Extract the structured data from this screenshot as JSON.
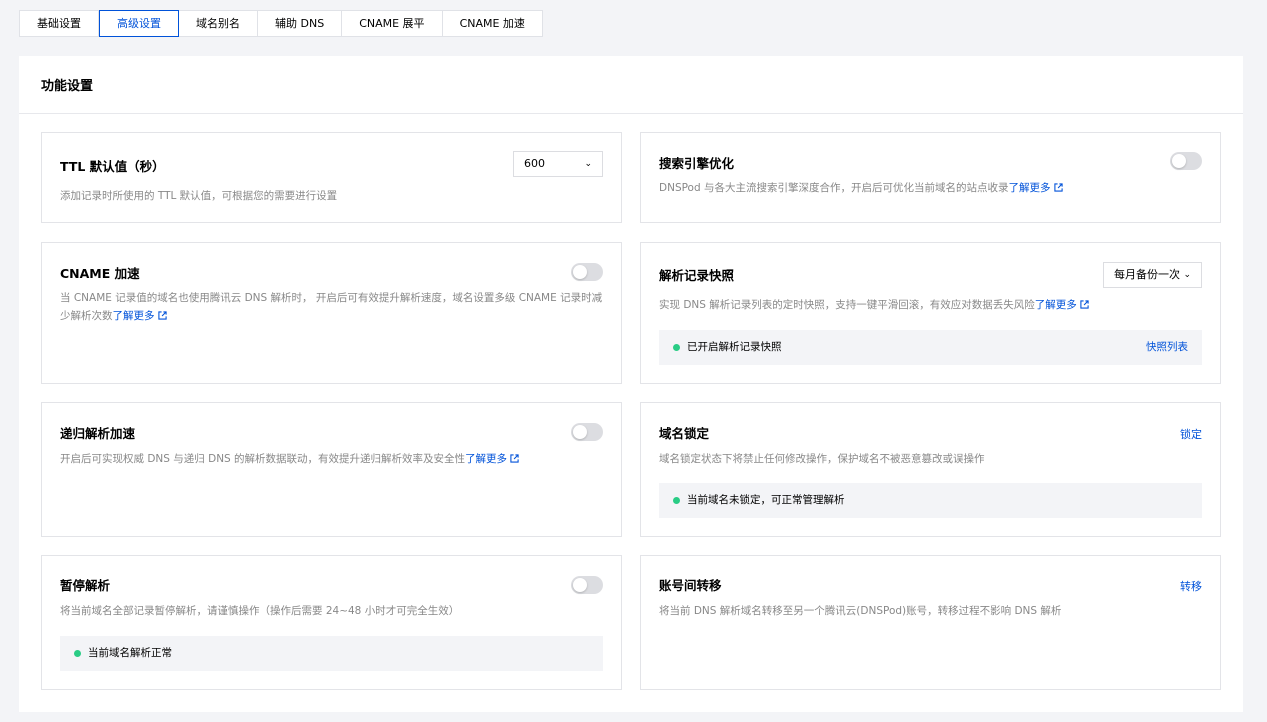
{
  "tabs": [
    "基础设置",
    "高级设置",
    "域名别名",
    "辅助 DNS",
    "CNAME 展平",
    "CNAME 加速"
  ],
  "active_tab": "高级设置",
  "panel": {
    "title": "功能设置"
  },
  "ttl": {
    "title": "TTL 默认值（秒）",
    "desc": "添加记录时所使用的 TTL 默认值，可根据您的需要进行设置",
    "value": "600"
  },
  "seo": {
    "title": "搜索引擎优化",
    "desc": "DNSPod 与各大主流搜索引擎深度合作，开启后可优化当前域名的站点收录",
    "link": "了解更多",
    "enabled": false
  },
  "cname_accel": {
    "title": "CNAME 加速",
    "desc": "当 CNAME 记录值的域名也使用腾讯云 DNS 解析时， 开启后可有效提升解析速度，域名设置多级 CNAME 记录时减少解析次数",
    "link": "了解更多",
    "enabled": false
  },
  "snapshot": {
    "title": "解析记录快照",
    "desc": "实现 DNS 解析记录列表的定时快照，支持一键平滑回滚，有效应对数据丢失风险",
    "link": "了解更多",
    "frequency": "每月备份一次",
    "status": "已开启解析记录快照",
    "action": "快照列表"
  },
  "recursive": {
    "title": "递归解析加速",
    "desc": "开启后可实现权威 DNS 与递归 DNS 的解析数据联动，有效提升递归解析效率及安全性",
    "link": "了解更多",
    "enabled": false
  },
  "lock": {
    "title": "域名锁定",
    "desc": "域名锁定状态下将禁止任何修改操作，保护域名不被恶意篡改或误操作",
    "action": "锁定",
    "status": "当前域名未锁定，可正常管理解析"
  },
  "pause": {
    "title": "暂停解析",
    "desc": "将当前域名全部记录暂停解析，请谨慎操作（操作后需要 24~48 小时才可完全生效）",
    "status": "当前域名解析正常",
    "enabled": false
  },
  "transfer": {
    "title": "账号间转移",
    "desc": "将当前 DNS 解析域名转移至另一个腾讯云(DNSPod)账号，转移过程不影响 DNS 解析",
    "action": "转移"
  },
  "colors": {
    "primary": "#0052d9",
    "success": "#29cc85",
    "toggle_off": "#dcdde1"
  }
}
